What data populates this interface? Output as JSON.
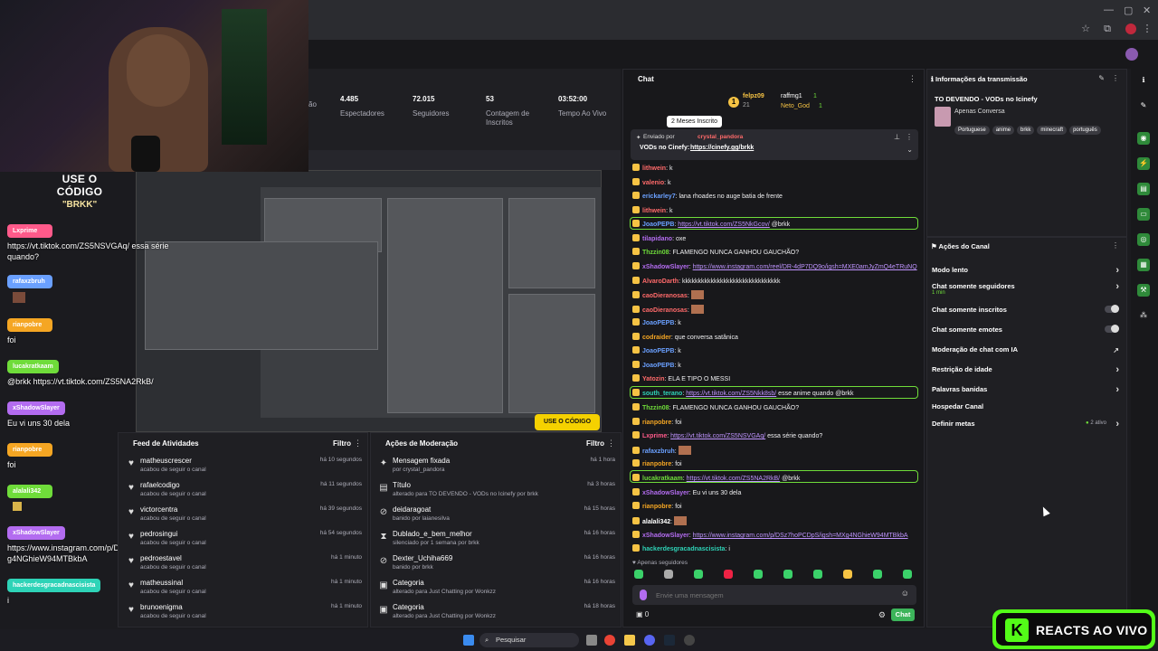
{
  "stats": [
    {
      "value": "",
      "label": "ssão"
    },
    {
      "value": "4.485",
      "label": "Espectadores"
    },
    {
      "value": "72.015",
      "label": "Seguidores"
    },
    {
      "value": "53",
      "label": "Contagem de Inscritos"
    },
    {
      "value": "03:52:00",
      "label": "Tempo Ao Vivo"
    }
  ],
  "overlay": {
    "code_line1": "USE O CÓDIGO",
    "code_line2": "\"BRKK\"",
    "scene_badge": "USE O CÓDIGO BRKK"
  },
  "left_chat": [
    {
      "user": "Lxprime",
      "color": "#ff5a8a",
      "text": "https://vt.tiktok.com/ZS5NSVGAq/ essa série quando?"
    },
    {
      "user": "rafaxzbruh",
      "color": "#6aa0ff",
      "text": ""
    },
    {
      "user": "rianpobre",
      "color": "#f5a623",
      "text": "foi"
    },
    {
      "user": "lucakratkaam",
      "color": "#6fdc3a",
      "text": "@brkk https://vt.tiktok.com/ZS5NA2RkB/"
    },
    {
      "user": "xShadowSlayer",
      "color": "#b36cf0",
      "text": "Eu vi uns 30 dela"
    },
    {
      "user": "rianpobre",
      "color": "#f5a623",
      "text": "foi"
    },
    {
      "user": "alalali342",
      "color": "#6fdc3a",
      "text": ""
    },
    {
      "user": "xShadowSlayer",
      "color": "#b36cf0",
      "text": "https://www.instagram.com/p/DSz7hoPCDpS/igsh=MXg4NGhieW94MTBkbA"
    },
    {
      "user": "hackerdesgracadnascisista",
      "color": "#2ed3b7",
      "text": "i"
    }
  ],
  "feed": {
    "title": "Feed de Atividades",
    "filter": "Filtro",
    "items": [
      {
        "name": "matheuscrescer",
        "sub": "acabou de seguir o canal",
        "time": "há 10 segundos"
      },
      {
        "name": "rafaelcodigo",
        "sub": "acabou de seguir o canal",
        "time": "há 11 segundos"
      },
      {
        "name": "victorcentra",
        "sub": "acabou de seguir o canal",
        "time": "há 39 segundos"
      },
      {
        "name": "pedrosingui",
        "sub": "acabou de seguir o canal",
        "time": "há 54 segundos"
      },
      {
        "name": "pedroestavel",
        "sub": "acabou de seguir o canal",
        "time": "há 1 minuto"
      },
      {
        "name": "matheussinal",
        "sub": "acabou de seguir o canal",
        "time": "há 1 minuto"
      },
      {
        "name": "brunoenigma",
        "sub": "acabou de seguir o canal",
        "time": "há 1 minuto"
      }
    ]
  },
  "mod": {
    "title": "Ações de Moderação",
    "filter": "Filtro",
    "items": [
      {
        "icon": "pin-icon",
        "glyph": "✦",
        "name": "Mensagem fixada",
        "sub": "por crystal_pandora",
        "time": "há 1 hora"
      },
      {
        "icon": "title-icon",
        "glyph": "▤",
        "name": "Título",
        "sub": "alterado para TO DEVENDO - VODs no Icinefy por brkk",
        "time": "há 3 horas"
      },
      {
        "icon": "ban-icon",
        "glyph": "⊘",
        "name": "deidaragoat",
        "sub": "banido por laianesilva",
        "time": "há 15 horas"
      },
      {
        "icon": "timeout-icon",
        "glyph": "⧗",
        "name": "Dublado_e_bem_melhor",
        "sub": "silenciado por 1 semana por brkk",
        "time": "há 16 horas"
      },
      {
        "icon": "ban-icon",
        "glyph": "⊘",
        "name": "Dexter_Uchiha669",
        "sub": "banido por brkk",
        "time": "há 16 horas"
      },
      {
        "icon": "category-icon",
        "glyph": "▣",
        "name": "Categoria",
        "sub": "alterado para Just Chatting por Wonkzz",
        "time": "há 16 horas"
      },
      {
        "icon": "category-icon",
        "glyph": "▣",
        "name": "Categoria",
        "sub": "alterado para Just Chatting por Wonkzz",
        "time": "há 18 horas"
      }
    ]
  },
  "chat": {
    "title": "Chat",
    "gifters": [
      {
        "name": "felpz09",
        "count": "21"
      },
      {
        "name": "raffmg1",
        "count": "1"
      },
      {
        "name": "Neto_God",
        "count": "1"
      }
    ],
    "tooltip": "2 Meses Inscrito",
    "pinned_by_label": "Enviado por",
    "pinned_by": "crystal_pandora",
    "pinned_text": "VODs no Cinefy:",
    "pinned_link": "https://cinefy.gg/brkk",
    "messages": [
      {
        "user": "lithwein",
        "color": "#ff6a6a",
        "text": "k",
        "link": ""
      },
      {
        "user": "valenio",
        "color": "#ff6a6a",
        "text": "k",
        "link": ""
      },
      {
        "user": "erickarley7",
        "color": "#6aa0ff",
        "text": "lana rhoades no auge batia de frente",
        "link": ""
      },
      {
        "user": "lithwein",
        "color": "#ff6a6a",
        "text": "k",
        "link": ""
      },
      {
        "user": "JoaoPEPB",
        "color": "#6aa0ff",
        "text": "@brkk",
        "link": "https://vt.tiktok.com/ZS5NkGcov/"
      },
      {
        "user": "tilapidano",
        "color": "#b36cf0",
        "text": "oxe",
        "link": ""
      },
      {
        "user": "Thzzin08",
        "color": "#6fdc3a",
        "text": "FLAMENGO NUNCA GANHOU GAUCHÃO?",
        "link": ""
      },
      {
        "user": "xShadowSlayer",
        "color": "#b36cf0",
        "text": "",
        "link": "https://www.instagram.com/reel/DR-4dP7DQ9o/igsh=MXE0amJyZmQ4eTRuNQ"
      },
      {
        "user": "AlvaroDarth",
        "color": "#ff6a6a",
        "text": "kkkkkkkkkkkkkkkkkkkkkkkkkkkkkkk",
        "link": ""
      },
      {
        "user": "caoDieranosas",
        "color": "#ff6a6a",
        "text": "",
        "link": ""
      },
      {
        "user": "caoDieranosas",
        "color": "#ff6a6a",
        "text": "",
        "link": ""
      },
      {
        "user": "JoaoPEPB",
        "color": "#6aa0ff",
        "text": "k",
        "link": ""
      },
      {
        "user": "codraider",
        "color": "#f5a623",
        "text": "que conversa satânica",
        "link": ""
      },
      {
        "user": "JoaoPEPB",
        "color": "#6aa0ff",
        "text": "k",
        "link": ""
      },
      {
        "user": "JoaoPEPB",
        "color": "#6aa0ff",
        "text": "k",
        "link": ""
      },
      {
        "user": "Yatozin",
        "color": "#ff6a6a",
        "text": "ELA E TIPO O MESSI",
        "link": ""
      },
      {
        "user": "south_terano",
        "color": "#2ed3b7",
        "text": "esse anime quando @brkk",
        "link": "https://vt.tiktok.com/ZS5Nkk8sb/"
      },
      {
        "user": "Thzzin08",
        "color": "#6fdc3a",
        "text": "FLAMENGO NUNCA GANHOU GAUCHÃO?",
        "link": ""
      },
      {
        "user": "rianpobre",
        "color": "#f5a623",
        "text": "foi",
        "link": ""
      },
      {
        "user": "Lxprime",
        "color": "#ff5a8a",
        "text": "essa série quando?",
        "link": "https://vt.tiktok.com/ZS5NSVGAq/"
      },
      {
        "user": "rafaxzbruh",
        "color": "#6aa0ff",
        "text": "",
        "link": ""
      },
      {
        "user": "rianpobre",
        "color": "#f5a623",
        "text": "foi",
        "link": ""
      },
      {
        "user": "lucakratkaam",
        "color": "#6fdc3a",
        "text": "@brkk",
        "link": "https://vt.tiktok.com/ZS5NA2RkB/"
      },
      {
        "user": "xShadowSlayer",
        "color": "#b36cf0",
        "text": "Eu vi uns 30 dela",
        "link": ""
      },
      {
        "user": "rianpobre",
        "color": "#f5a623",
        "text": "foi",
        "link": ""
      },
      {
        "user": "alalali342",
        "color": "#ffffff",
        "text": "",
        "link": ""
      },
      {
        "user": "xShadowSlayer",
        "color": "#b36cf0",
        "text": "",
        "link": "https://www.instagram.com/p/DSz7hoPCDpS/igsh=MXg4NGhieW94MTBkbA"
      },
      {
        "user": "hackerdesgracadnascisista",
        "color": "#2ed3b7",
        "text": "i",
        "link": ""
      }
    ],
    "mode": "Apenas seguidores",
    "placeholder": "Envie uma mensagem",
    "points": "0",
    "send": "Chat"
  },
  "info": {
    "title": "Informações da transmissão",
    "stream_title": "TO DEVENDO - VODs no Icinefy",
    "category": "Apenas Conversa",
    "tags": [
      "Portuguese",
      "anime",
      "brkk",
      "minecraft",
      "português"
    ]
  },
  "acoes": {
    "title": "Ações do Canal",
    "rows": [
      {
        "label": "Modo lento",
        "sub": "",
        "ctrl": "chevron"
      },
      {
        "label": "Chat somente seguidores",
        "sub": "1 min",
        "ctrl": "chevron"
      },
      {
        "label": "Chat somente inscritos",
        "sub": "",
        "ctrl": "toggle"
      },
      {
        "label": "Chat somente emotes",
        "sub": "",
        "ctrl": "toggle"
      },
      {
        "label": "Moderação de chat com IA",
        "sub": "",
        "ctrl": "external"
      },
      {
        "label": "Restrição de idade",
        "sub": "",
        "ctrl": "chevron"
      },
      {
        "label": "Palavras banidas",
        "sub": "",
        "ctrl": "chevron"
      },
      {
        "label": "Hospedar Canal",
        "sub": "",
        "ctrl": "none"
      },
      {
        "label": "Definir metas",
        "sub": "",
        "ctrl": "chevron"
      }
    ],
    "goals_active": "2 ativo"
  },
  "taskbar": {
    "search": "Pesquisar"
  },
  "reacts": {
    "label": "REACTS AO VIVO",
    "logo": "K"
  },
  "colors": {
    "kick_green": "#53fc18",
    "highlight": "#6fdc3a",
    "link": "#bf94ff"
  }
}
